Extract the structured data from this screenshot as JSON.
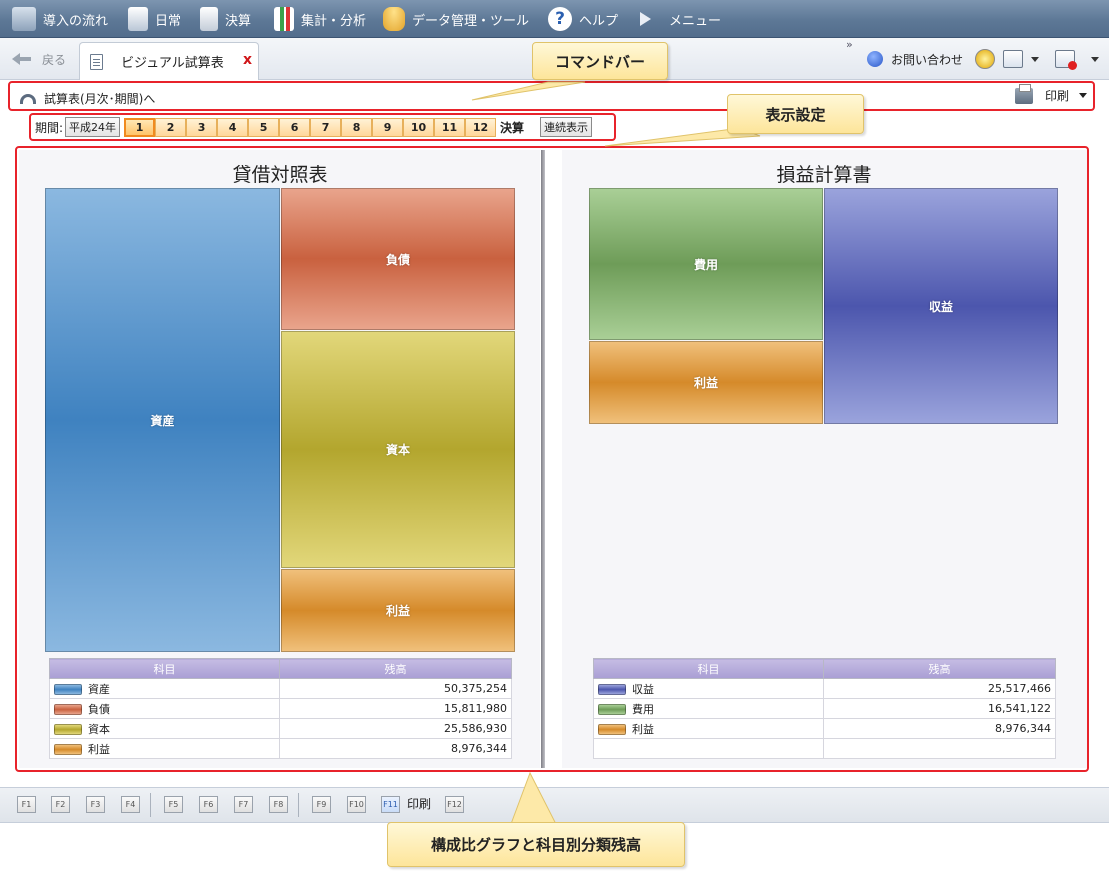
{
  "menubar": {
    "items": [
      {
        "label": "導入の流れ"
      },
      {
        "label": "日常"
      },
      {
        "label": "決算"
      },
      {
        "label": "集計・分析"
      },
      {
        "label": "データ管理・ツール"
      },
      {
        "label": "ヘルプ"
      },
      {
        "label": "メニュー"
      }
    ],
    "color": "#5d7896"
  },
  "tabrow": {
    "back_label": "戻る",
    "tab_label": "ビジュアル試算表",
    "tab_close": "x",
    "overflow": "»",
    "contact_label": "お問い合わせ"
  },
  "cmdbar": {
    "link_label": "試算表(月次･期間)へ",
    "print_label": "印刷"
  },
  "period": {
    "label": "期間:",
    "year": "平成24年",
    "months": [
      "1",
      "2",
      "3",
      "4",
      "5",
      "6",
      "7",
      "8",
      "9",
      "10",
      "11",
      "12"
    ],
    "selected_month": "1",
    "kessan": "決算",
    "continuous": "連続表示"
  },
  "balance_sheet": {
    "title": "貸借対照表",
    "blocks": {
      "asset": "資産",
      "liability": "負債",
      "capital": "資本",
      "profit": "利益"
    },
    "table": {
      "headers": [
        "科目",
        "残高"
      ],
      "rows": [
        {
          "name": "資産",
          "value": "50,375,254",
          "color": "#3f82c0"
        },
        {
          "name": "負債",
          "value": "15,811,980",
          "color": "#c9613f"
        },
        {
          "name": "資本",
          "value": "25,586,930",
          "color": "#b3a62e"
        },
        {
          "name": "利益",
          "value": "8,976,344",
          "color": "#d58a2a"
        }
      ]
    }
  },
  "income_statement": {
    "title": "損益計算書",
    "blocks": {
      "expense": "費用",
      "profit": "利益",
      "revenue": "収益"
    },
    "table": {
      "headers": [
        "科目",
        "残高"
      ],
      "rows": [
        {
          "name": "収益",
          "value": "25,517,466",
          "color": "#4c56ad"
        },
        {
          "name": "費用",
          "value": "16,541,122",
          "color": "#6e9c58"
        },
        {
          "name": "利益",
          "value": "8,976,344",
          "color": "#d58a2a"
        }
      ]
    }
  },
  "fkeys": {
    "keys": [
      "F1",
      "F2",
      "F3",
      "F4",
      "F5",
      "F6",
      "F7",
      "F8",
      "F9",
      "F10",
      "F11",
      "F12"
    ],
    "f11_label": "印刷"
  },
  "callouts": {
    "command_bar": "コマンドバー",
    "display_settings": "表示設定",
    "graph_note": "構成比グラフと科目別分類残高"
  },
  "accent_red": "#e8232b"
}
